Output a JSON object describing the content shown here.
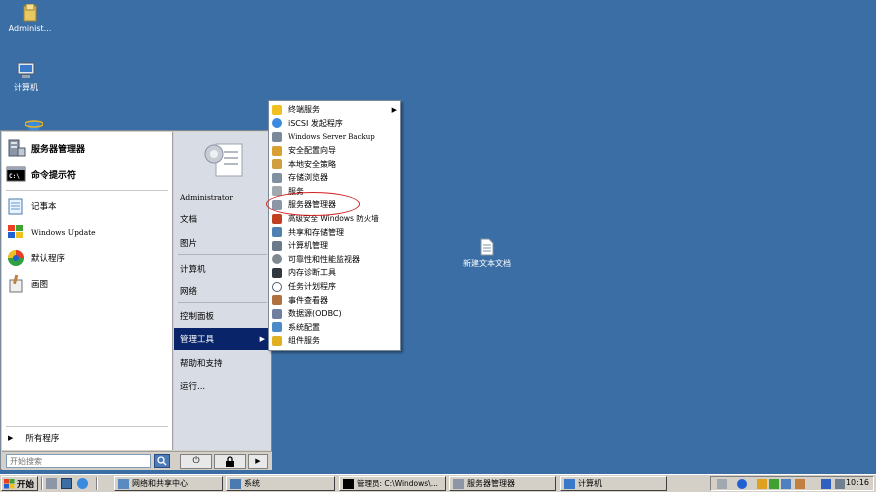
{
  "desktop": {
    "icons": [
      {
        "name": "Administ..."
      },
      {
        "name": "计算机"
      },
      {
        "name": "新建文本文档"
      }
    ]
  },
  "start_menu": {
    "pinned": [
      "服务器管理器",
      "命令提示符"
    ],
    "recent": [
      "记事本",
      "Windows Update",
      "默认程序",
      "画图"
    ],
    "all_programs": "所有程序",
    "search_placeholder": "开始搜索",
    "right": {
      "user": "Administrator",
      "items": [
        "文档",
        "图片",
        "计算机",
        "网络",
        "控制面板",
        "管理工具",
        "帮助和支持",
        "运行..."
      ]
    }
  },
  "admin_tools_menu": {
    "items": [
      "终端服务",
      "iSCSI 发起程序",
      "Windows Server Backup",
      "安全配置向导",
      "本地安全策略",
      "存储浏览器",
      "服务",
      "服务器管理器",
      "高级安全 Windows 防火墙",
      "共享和存储管理",
      "计算机管理",
      "可靠性和性能监视器",
      "内存诊断工具",
      "任务计划程序",
      "事件查看器",
      "数据源(ODBC)",
      "系统配置",
      "组件服务"
    ],
    "highlighted": "服务器管理器"
  },
  "taskbar": {
    "start_label": "开始",
    "buttons": [
      "网络和共享中心",
      "系统",
      "管理员: C:\\Windows\\...",
      "服务器管理器",
      "计算机"
    ],
    "clock": "10:16"
  },
  "colors": {
    "desktop": "#3a6ea5",
    "menu_highlight": "#0a246a",
    "annotation_ellipse": "#d42020"
  }
}
